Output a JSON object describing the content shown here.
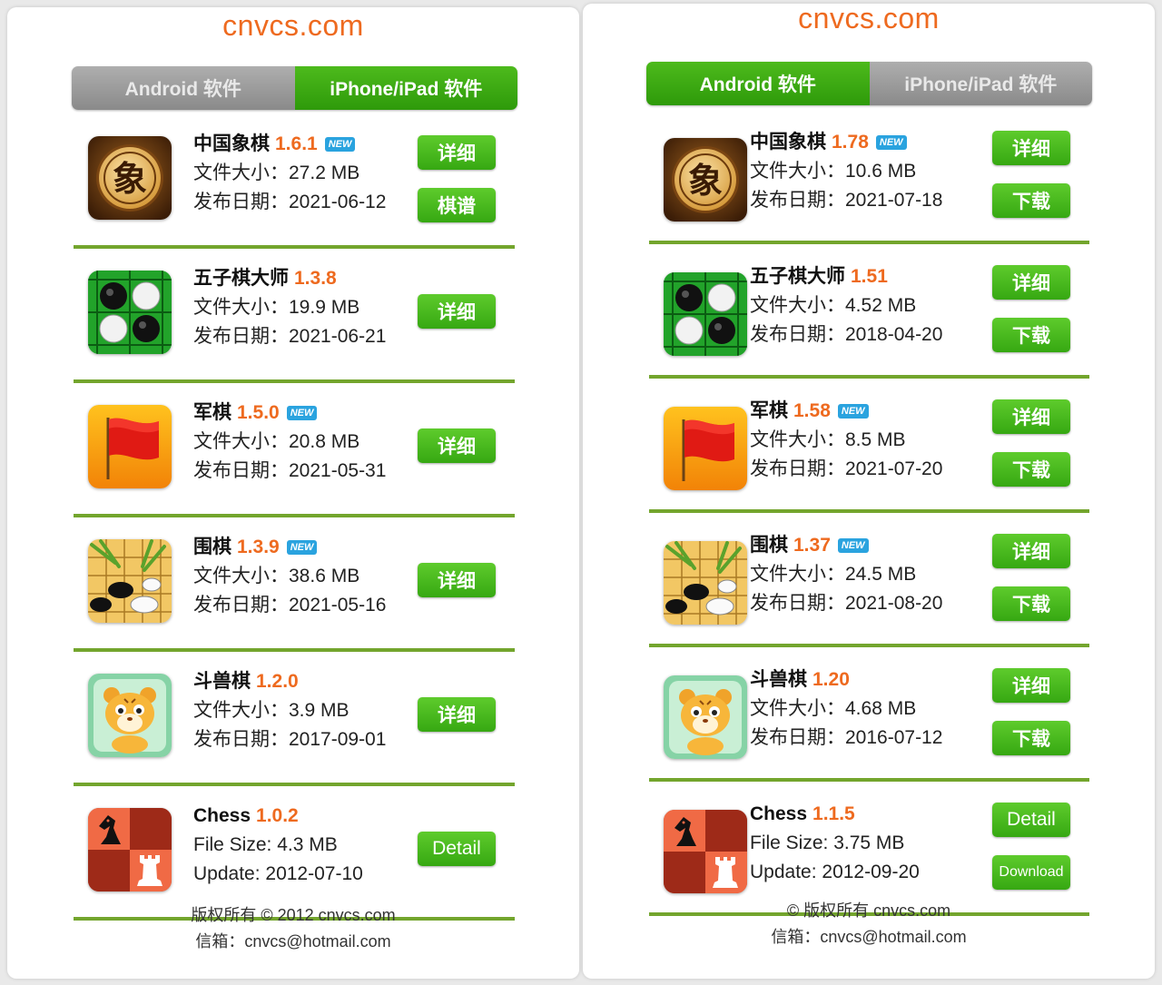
{
  "left": {
    "site_title": "cnvcs.com",
    "tabs": [
      {
        "label": "Android 软件",
        "active": false
      },
      {
        "label": "iPhone/iPad 软件",
        "active": true
      }
    ],
    "apps": [
      {
        "icon": "xiangqi-icon",
        "name": "中国象棋",
        "version": "1.6.1",
        "new_badge": "NEW",
        "size_line": "文件大小：27.2 MB",
        "date_line": "发布日期：2021-06-12",
        "buttons": [
          "详细",
          "棋谱"
        ]
      },
      {
        "icon": "gomoku-icon",
        "name": "五子棋大师",
        "version": "1.3.8",
        "new_badge": "",
        "size_line": "文件大小：19.9 MB",
        "date_line": "发布日期：2021-06-21",
        "buttons": [
          "详细"
        ]
      },
      {
        "icon": "flag-icon",
        "name": "军棋",
        "version": "1.5.0",
        "new_badge": "NEW",
        "size_line": "文件大小：20.8 MB",
        "date_line": "发布日期：2021-05-31",
        "buttons": [
          "详细"
        ]
      },
      {
        "icon": "go-icon",
        "name": "围棋",
        "version": "1.3.9",
        "new_badge": "NEW",
        "size_line": "文件大小：38.6 MB",
        "date_line": "发布日期：2021-05-16",
        "buttons": [
          "详细"
        ]
      },
      {
        "icon": "tiger-icon",
        "name": "斗兽棋",
        "version": "1.2.0",
        "new_badge": "",
        "size_line": "文件大小：3.9 MB",
        "date_line": "发布日期：2017-09-01",
        "buttons": [
          "详细"
        ]
      },
      {
        "icon": "chess-icon",
        "name": "Chess",
        "version": "1.0.2",
        "new_badge": "",
        "size_line": "File Size: 4.3 MB",
        "date_line": "Update: 2012-07-10",
        "buttons": [
          "Detail"
        ]
      }
    ],
    "footer": {
      "copyright": "版权所有 © 2012 cnvcs.com",
      "email": "信箱：cnvcs@hotmail.com"
    }
  },
  "right": {
    "site_title": "cnvcs.com",
    "tabs": [
      {
        "label": "Android 软件",
        "active": true
      },
      {
        "label": "iPhone/iPad 软件",
        "active": false
      }
    ],
    "apps": [
      {
        "icon": "xiangqi-icon",
        "name": "中国象棋",
        "version": "1.78",
        "new_badge": "NEW",
        "size_line": "文件大小：10.6 MB",
        "date_line": "发布日期：2021-07-18",
        "buttons": [
          "详细",
          "下载"
        ]
      },
      {
        "icon": "gomoku-icon",
        "name": "五子棋大师",
        "version": "1.51",
        "new_badge": "",
        "size_line": "文件大小：4.52 MB",
        "date_line": "发布日期：2018-04-20",
        "buttons": [
          "详细",
          "下载"
        ]
      },
      {
        "icon": "flag-icon",
        "name": "军棋",
        "version": "1.58",
        "new_badge": "NEW",
        "size_line": "文件大小：8.5 MB",
        "date_line": "发布日期：2021-07-20",
        "buttons": [
          "详细",
          "下载"
        ]
      },
      {
        "icon": "go-icon",
        "name": "围棋",
        "version": "1.37",
        "new_badge": "NEW",
        "size_line": "文件大小：24.5 MB",
        "date_line": "发布日期：2021-08-20",
        "buttons": [
          "详细",
          "下载"
        ]
      },
      {
        "icon": "tiger-icon",
        "name": "斗兽棋",
        "version": "1.20",
        "new_badge": "",
        "size_line": "文件大小：4.68 MB",
        "date_line": "发布日期：2016-07-12",
        "buttons": [
          "详细",
          "下载"
        ]
      },
      {
        "icon": "chess-icon",
        "name": "Chess",
        "version": "1.1.5",
        "new_badge": "",
        "size_line": "File Size: 3.75 MB",
        "date_line": "Update: 2012-09-20",
        "buttons": [
          "Detail",
          "Download"
        ]
      }
    ],
    "footer": {
      "copyright": "© 版权所有 cnvcs.com",
      "email": "信箱：cnvcs@hotmail.com"
    }
  },
  "colors": {
    "accent_green": "#3aa913",
    "version_orange": "#ee6a1f",
    "divider_green": "#73a52d",
    "new_badge_blue": "#2aa3df"
  }
}
